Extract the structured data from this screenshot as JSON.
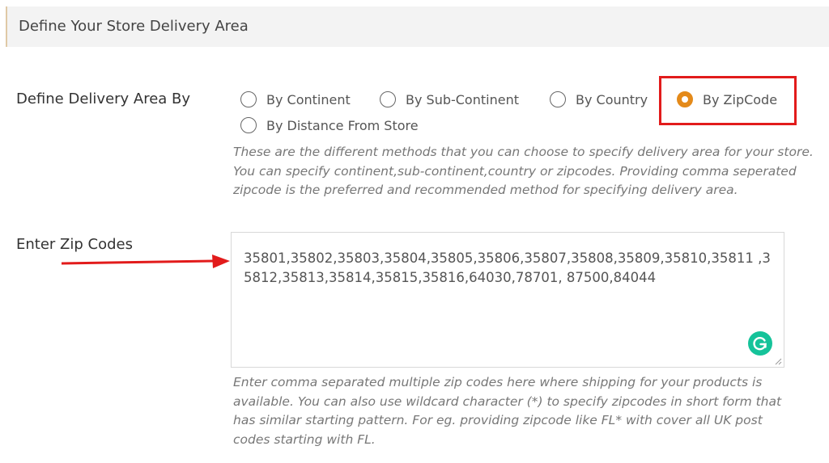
{
  "header": {
    "title": "Define Your Store Delivery Area"
  },
  "delivery_area": {
    "label": "Define Delivery Area By",
    "options": [
      {
        "label": "By Continent",
        "selected": false
      },
      {
        "label": "By Sub-Continent",
        "selected": false
      },
      {
        "label": "By Country",
        "selected": false
      },
      {
        "label": "By ZipCode",
        "selected": true
      },
      {
        "label": "By Distance From Store",
        "selected": false
      }
    ],
    "help": "These are the different methods that you can choose to specify delivery area for your store. You can specify continent,sub-continent,country or zipcodes. Providing comma seperated zipcode is the preferred and recommended method for specifying delivery area."
  },
  "zip_codes": {
    "label": "Enter Zip Codes",
    "value": "35801,35802,35803,35804,35805,35806,35807,35808,35809,35810,35811 ,35812,35813,35814,35815,35816,64030,78701, 87500,84044",
    "help": "Enter comma separated multiple zip codes here where shipping for your products is available. You can also use wildcard character (*) to specify zipcodes in short form that has similar starting pattern. For eg. providing zipcode like FL* with cover all UK post codes starting with FL."
  },
  "colors": {
    "accent_radio": "#e48a1a",
    "highlight": "#e21b1b",
    "grammarly": "#15c39a"
  },
  "icons": {
    "grammarly": "grammarly-icon",
    "resize": "resize-handle-icon",
    "annotation_arrow": "arrow-right-icon"
  }
}
